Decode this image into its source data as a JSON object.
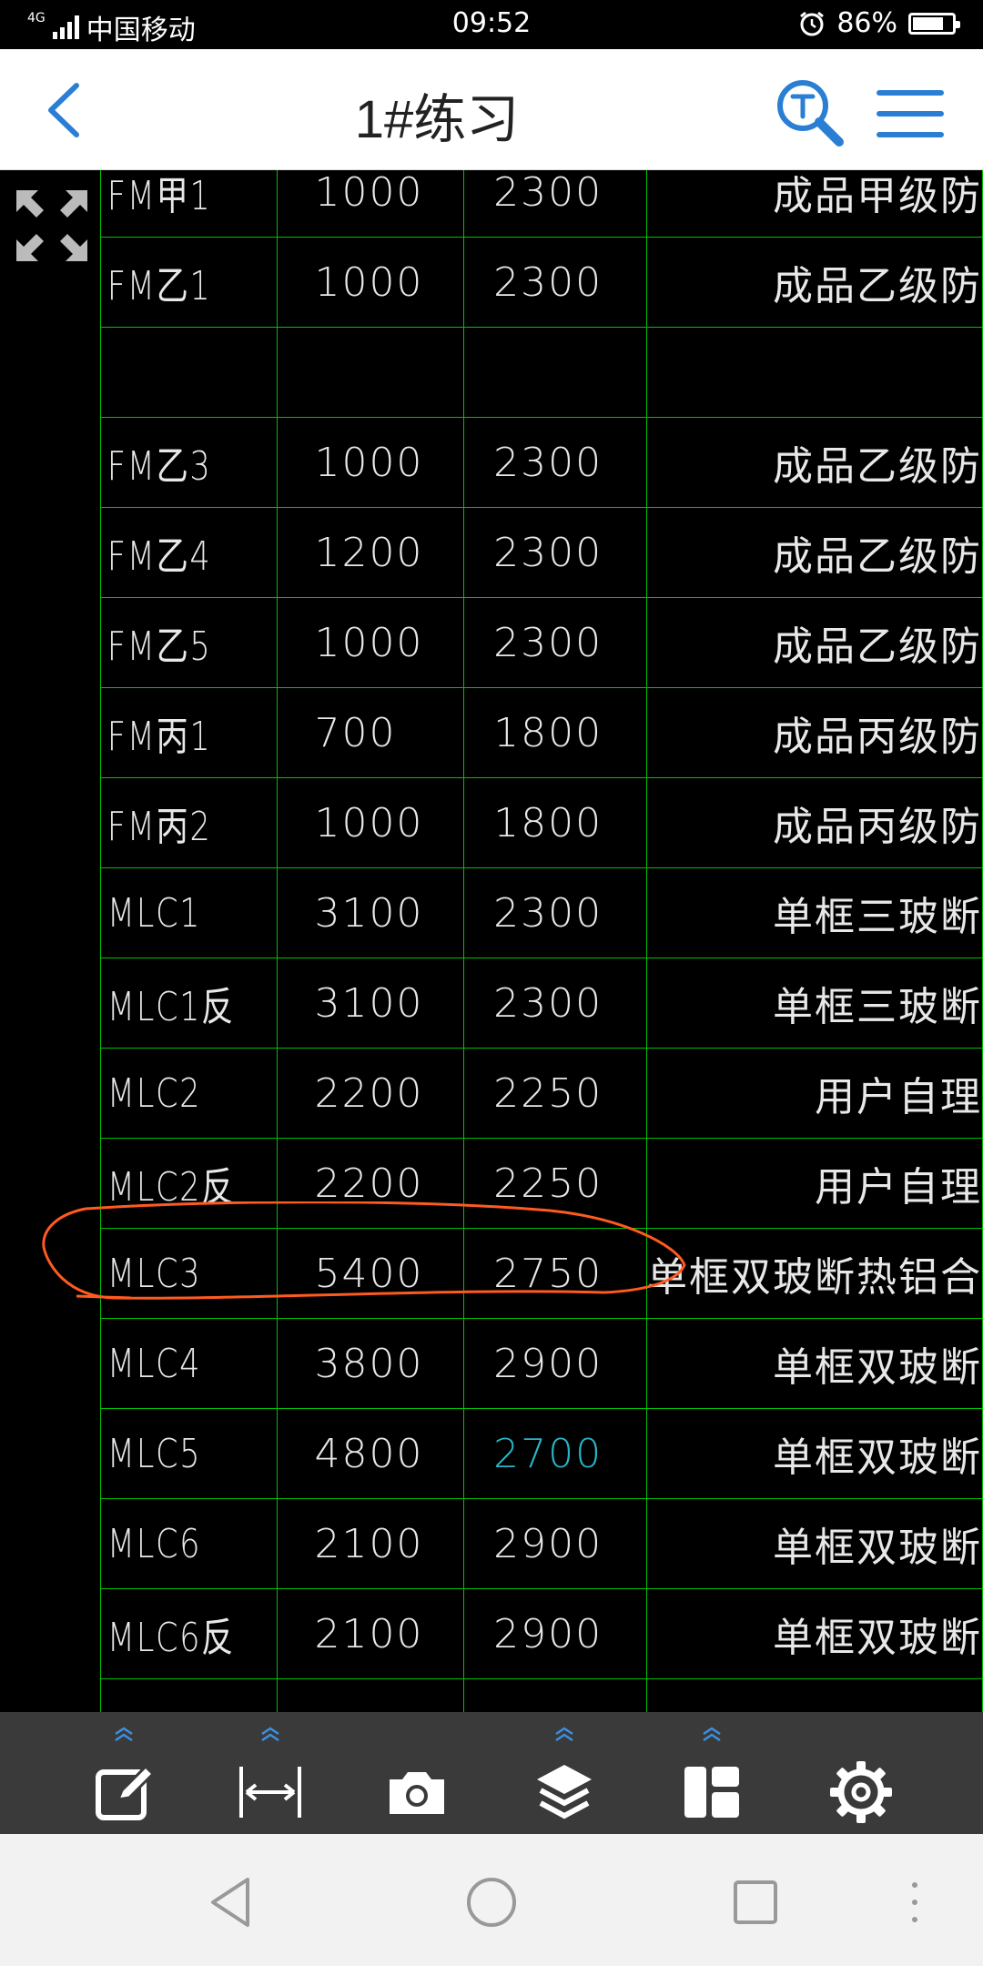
{
  "status_bar": {
    "network": "4G",
    "carrier": "中国移动",
    "time": "09:52",
    "battery_percent": "86%",
    "battery_level": 0.86
  },
  "header": {
    "title": "1#练习",
    "back_icon": "chevron-left-icon",
    "search_icon": "text-search-icon",
    "menu_icon": "hamburger-menu-icon"
  },
  "canvas": {
    "fit_icon": "fit-screen-icon",
    "highlight_color": "#ff5a1f",
    "grid_color": "#00c000",
    "rows": [
      {
        "name": "FM甲1",
        "width": "1000",
        "height": "2300",
        "desc": "成品甲级防"
      },
      {
        "name": "FM乙1",
        "width": "1000",
        "height": "2300",
        "desc": "成品乙级防"
      },
      {
        "name": "",
        "width": "",
        "height": "",
        "desc": ""
      },
      {
        "name": "FM乙3",
        "width": "1000",
        "height": "2300",
        "desc": "成品乙级防"
      },
      {
        "name": "FM乙4",
        "width": "1200",
        "height": "2300",
        "desc": "成品乙级防"
      },
      {
        "name": "FM乙5",
        "width": "1000",
        "height": "2300",
        "desc": "成品乙级防"
      },
      {
        "name": "FM丙1",
        "width": "700",
        "height": "1800",
        "desc": "成品丙级防"
      },
      {
        "name": "FM丙2",
        "width": "1000",
        "height": "1800",
        "desc": "成品丙级防"
      },
      {
        "name": "MLC1",
        "width": "3100",
        "height": "2300",
        "desc": "单框三玻断"
      },
      {
        "name": "MLC1反",
        "width": "3100",
        "height": "2300",
        "desc": "单框三玻断"
      },
      {
        "name": "MLC2",
        "width": "2200",
        "height": "2250",
        "desc": "用户自理"
      },
      {
        "name": "MLC2反",
        "width": "2200",
        "height": "2250",
        "desc": "用户自理"
      },
      {
        "name": "MLC3",
        "width": "5400",
        "height": "2750",
        "desc": "单框双玻断热铝合"
      },
      {
        "name": "MLC4",
        "width": "3800",
        "height": "2900",
        "desc": "单框双玻断"
      },
      {
        "name": "MLC5",
        "width": "4800",
        "height": "2700",
        "desc": "单框双玻断"
      },
      {
        "name": "MLC6",
        "width": "2100",
        "height": "2900",
        "desc": "单框双玻断"
      },
      {
        "name": "MLC6反",
        "width": "2100",
        "height": "2900",
        "desc": "单框双玻断"
      },
      {
        "name": "",
        "width": "",
        "height": "",
        "desc": ""
      }
    ]
  },
  "toolbar": {
    "items": [
      {
        "icon": "annotate-edit-icon",
        "has_expand": true
      },
      {
        "icon": "measure-distance-icon",
        "has_expand": true
      },
      {
        "icon": "camera-icon",
        "has_expand": false
      },
      {
        "icon": "layers-icon",
        "has_expand": true
      },
      {
        "icon": "layout-panels-icon",
        "has_expand": true
      },
      {
        "icon": "settings-gear-icon",
        "has_expand": false
      }
    ]
  },
  "nav_bar": {
    "back": "triangle-back-icon",
    "home": "circle-home-icon",
    "recents": "square-recents-icon"
  }
}
